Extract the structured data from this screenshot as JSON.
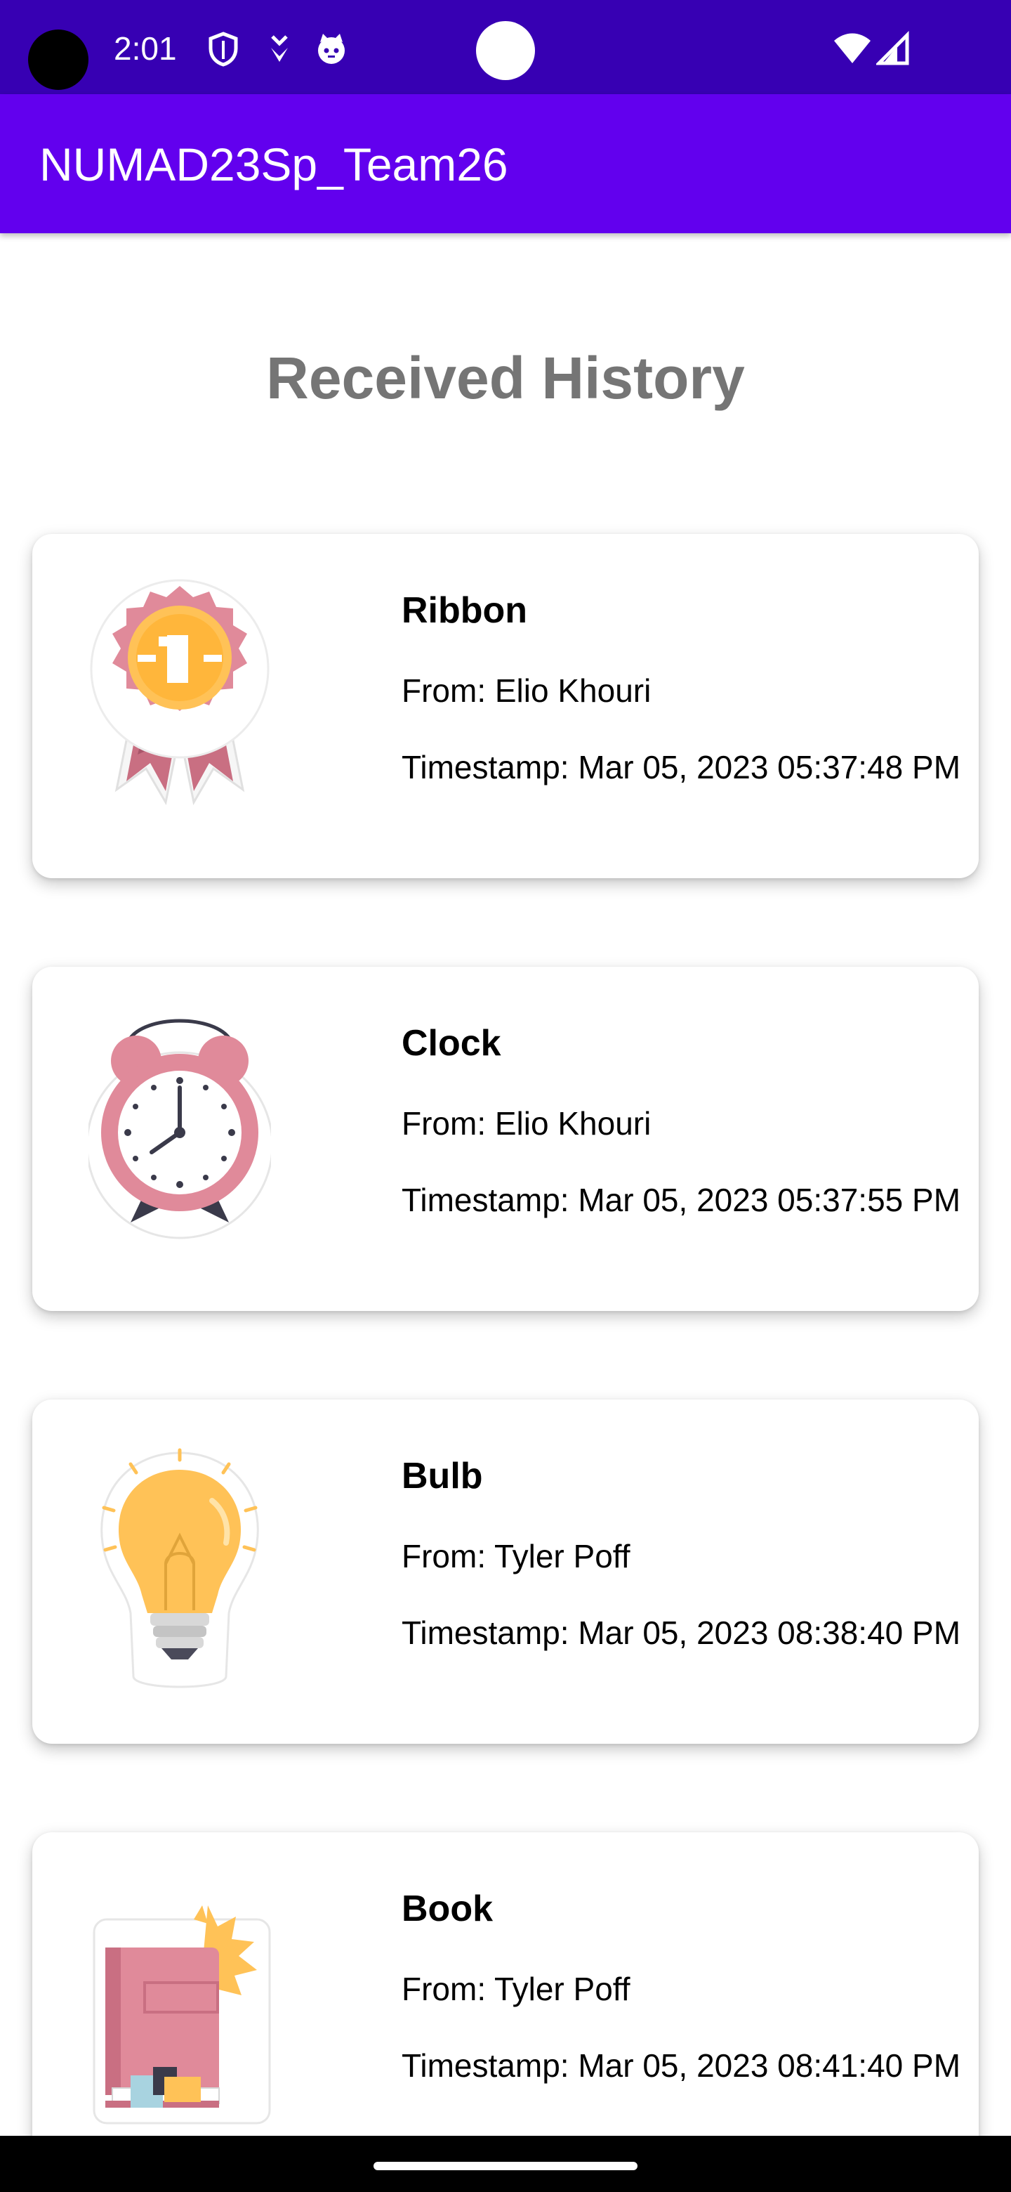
{
  "status_bar": {
    "time": "2:01",
    "left_icons": [
      "shield-icon",
      "download-icon",
      "cat-face-icon"
    ],
    "right_icons": [
      "wifi-icon",
      "cell-signal-icon"
    ]
  },
  "app_bar": {
    "title": "NUMAD23Sp_Team26"
  },
  "page": {
    "title": "Received History"
  },
  "items": [
    {
      "sticker": "ribbon-icon",
      "name": "Ribbon",
      "from": "From: Elio Khouri",
      "timestamp": "Timestamp: Mar 05, 2023 05:37:48 PM"
    },
    {
      "sticker": "clock-icon",
      "name": "Clock",
      "from": "From: Elio Khouri",
      "timestamp": "Timestamp: Mar 05, 2023 05:37:55 PM"
    },
    {
      "sticker": "bulb-icon",
      "name": "Bulb",
      "from": "From: Tyler Poff",
      "timestamp": "Timestamp: Mar 05, 2023 08:38:40 PM"
    },
    {
      "sticker": "book-icon",
      "name": "Book",
      "from": "From: Tyler Poff",
      "timestamp": "Timestamp: Mar 05, 2023 08:41:40 PM"
    }
  ],
  "colors": {
    "status_bar": "#3700b3",
    "app_bar": "#6200ee",
    "page_title": "#757575",
    "sticker_pink": "#e08a9a",
    "sticker_yellow": "#ffc257"
  }
}
